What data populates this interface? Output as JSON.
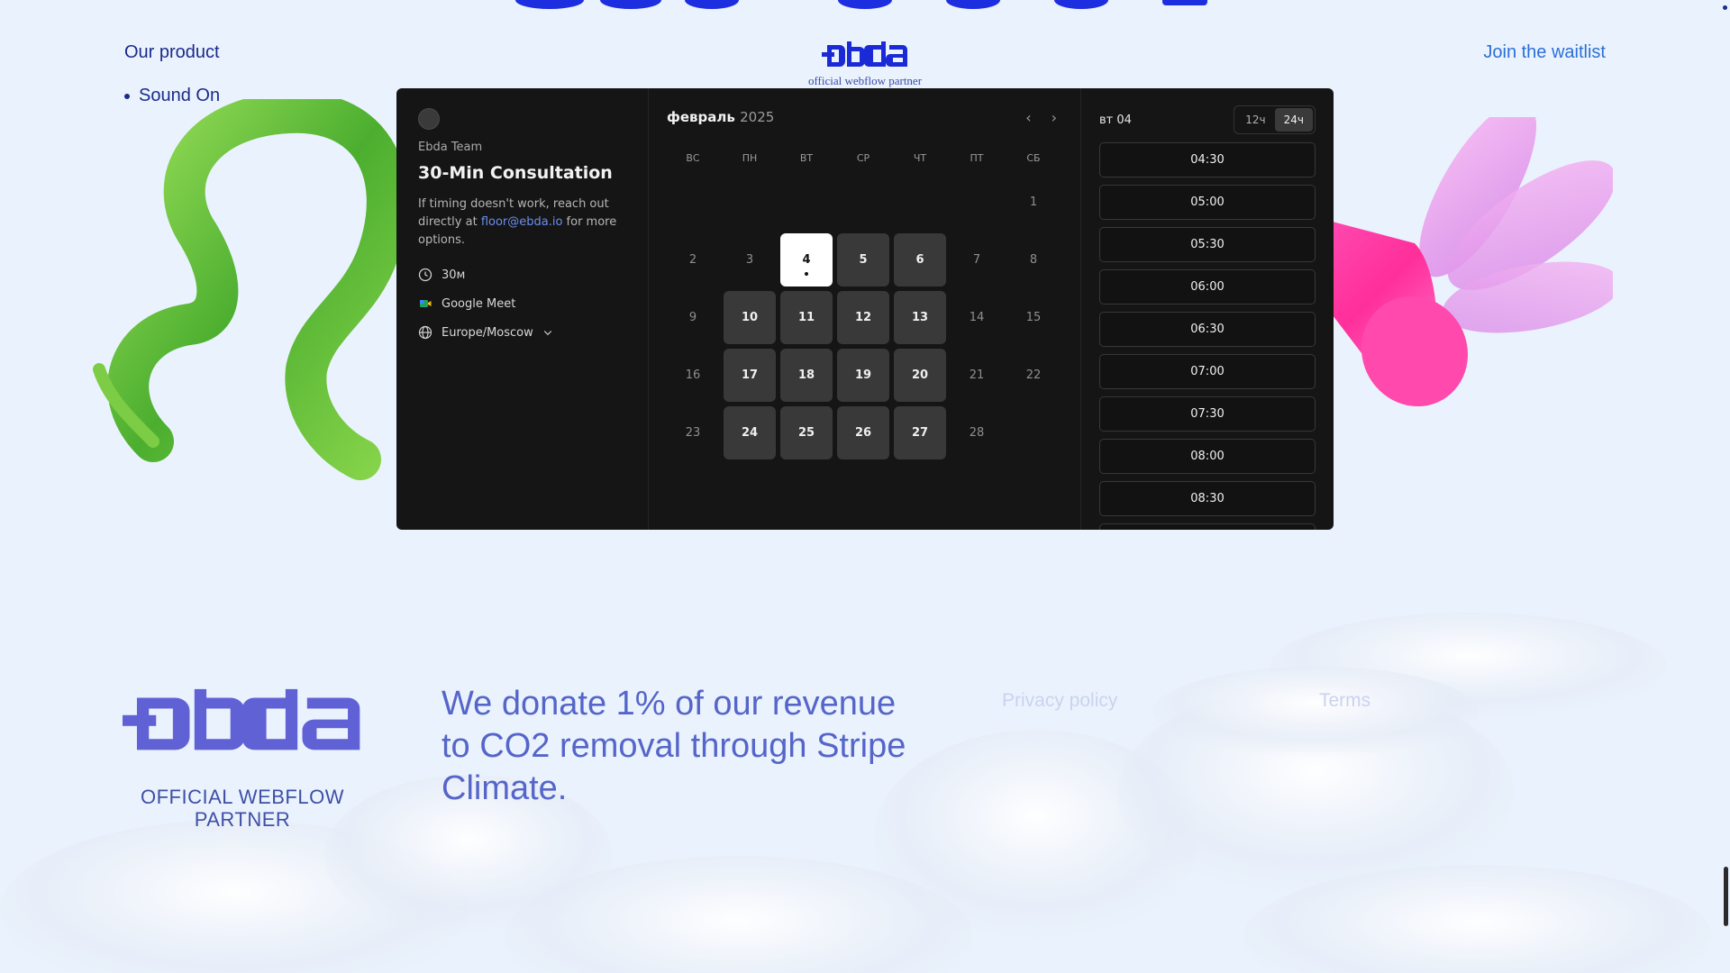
{
  "nav": {
    "our_product": "Our product",
    "sound_on": "Sound On",
    "join_waitlist": "Join the waitlist"
  },
  "header": {
    "logo_text": "ebda",
    "partner_tag": "official webflow partner"
  },
  "booking": {
    "team": "Ebda Team",
    "title": "30-Min Consultation",
    "desc_part1": "If timing doesn't work, reach out directly at ",
    "email": "floor@ebda.io",
    "desc_part2": " for more options.",
    "duration": "30м",
    "location": "Google Meet",
    "timezone": "Europe/Moscow",
    "month": "февраль",
    "year": "2025",
    "weekdays": [
      "ВС",
      "ПН",
      "ВТ",
      "СР",
      "ЧТ",
      "ПТ",
      "СБ"
    ],
    "days": [
      {
        "d": "",
        "s": "empty"
      },
      {
        "d": "",
        "s": "empty"
      },
      {
        "d": "",
        "s": "empty"
      },
      {
        "d": "",
        "s": "empty"
      },
      {
        "d": "",
        "s": "empty"
      },
      {
        "d": "",
        "s": "empty"
      },
      {
        "d": "1",
        "s": "off"
      },
      {
        "d": "2",
        "s": "off"
      },
      {
        "d": "3",
        "s": "off"
      },
      {
        "d": "4",
        "s": "selected"
      },
      {
        "d": "5",
        "s": "available"
      },
      {
        "d": "6",
        "s": "available"
      },
      {
        "d": "7",
        "s": "off"
      },
      {
        "d": "8",
        "s": "off"
      },
      {
        "d": "9",
        "s": "off"
      },
      {
        "d": "10",
        "s": "available"
      },
      {
        "d": "11",
        "s": "available"
      },
      {
        "d": "12",
        "s": "available"
      },
      {
        "d": "13",
        "s": "available"
      },
      {
        "d": "14",
        "s": "off"
      },
      {
        "d": "15",
        "s": "off"
      },
      {
        "d": "16",
        "s": "off"
      },
      {
        "d": "17",
        "s": "available"
      },
      {
        "d": "18",
        "s": "available"
      },
      {
        "d": "19",
        "s": "available"
      },
      {
        "d": "20",
        "s": "available"
      },
      {
        "d": "21",
        "s": "off"
      },
      {
        "d": "22",
        "s": "off"
      },
      {
        "d": "23",
        "s": "off"
      },
      {
        "d": "24",
        "s": "available"
      },
      {
        "d": "25",
        "s": "available"
      },
      {
        "d": "26",
        "s": "available"
      },
      {
        "d": "27",
        "s": "available"
      },
      {
        "d": "28",
        "s": "off"
      },
      {
        "d": "",
        "s": "empty"
      }
    ],
    "selected_day_label": "вт 04",
    "format_12": "12ч",
    "format_24": "24ч",
    "active_format": "24h",
    "times": [
      "04:30",
      "05:00",
      "05:30",
      "06:00",
      "06:30",
      "07:00",
      "07:30",
      "08:00",
      "08:30",
      ""
    ]
  },
  "footer": {
    "logo_text": "ebda",
    "partner_tag": "OFFICIAL WEBFLOW PARTNER",
    "donate": "We donate 1% of our revenue to CO2 removal through Stripe Climate.",
    "privacy": "Privacy policy",
    "terms": "Terms"
  },
  "colors": {
    "background": "#eaf3fd",
    "brand_blue": "#1a2a8c",
    "link_blue": "#2b6fd6",
    "footer_logo": "#6161d6",
    "widget_bg": "#151515"
  },
  "icons": [
    "clock-icon",
    "google-meet-icon",
    "globe-icon",
    "chevron-down-icon",
    "chevron-left-icon",
    "chevron-right-icon"
  ]
}
